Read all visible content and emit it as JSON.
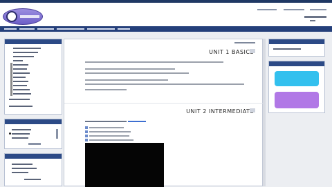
{
  "header": {
    "links": [
      "",
      "",
      ""
    ]
  },
  "nav": {
    "items": [
      "",
      "",
      "",
      "",
      "",
      "",
      ""
    ]
  },
  "main": {
    "unit1_title": "UNIT 1 BASICS",
    "unit2_title": "UNIT 2 INTERMEDIATE"
  },
  "colors": {
    "nav": "#243f7a",
    "accent_cyan": "#33c0ee",
    "accent_purple": "#b178e6"
  }
}
